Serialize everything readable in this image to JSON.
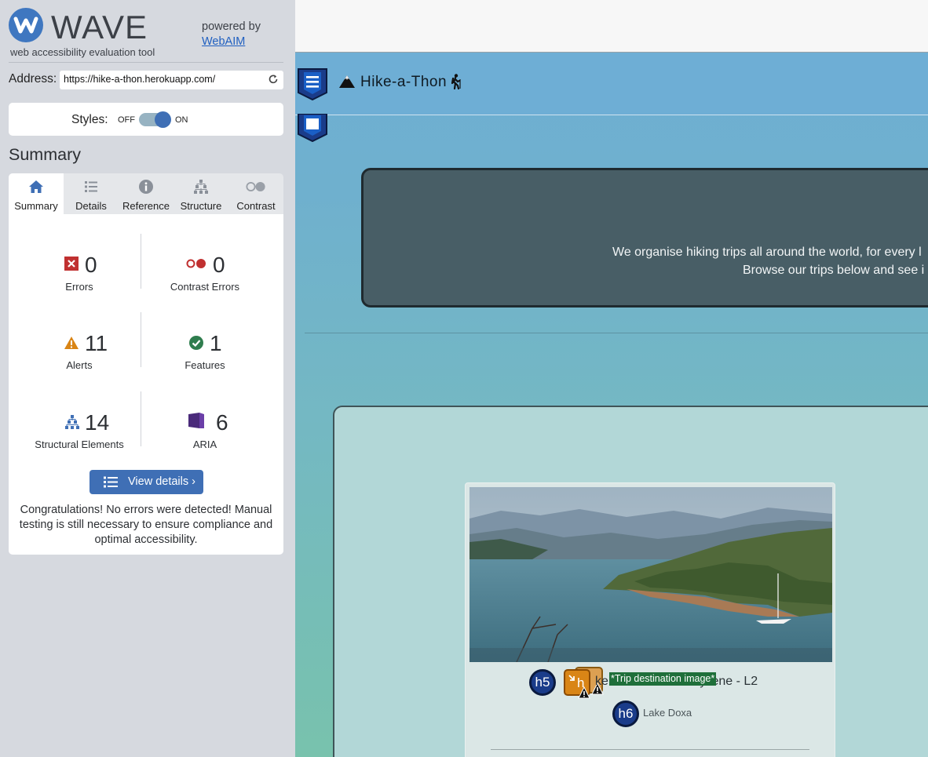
{
  "wave": {
    "logo_text": "WAVE",
    "tagline": "web accessibility evaluation tool",
    "powered_by": "powered by",
    "powered_link": "WebAIM",
    "address_label": "Address:",
    "address_value": "https://hike-a-thon.herokuapp.com/",
    "styles_label": "Styles:",
    "styles_off": "OFF",
    "styles_on": "ON",
    "styles_enabled": true,
    "summary_heading": "Summary",
    "tabs": [
      {
        "label": "Summary",
        "icon": "home-icon",
        "active": true
      },
      {
        "label": "Details",
        "icon": "list-icon",
        "active": false
      },
      {
        "label": "Reference",
        "icon": "info-icon",
        "active": false
      },
      {
        "label": "Structure",
        "icon": "structure-icon",
        "active": false
      },
      {
        "label": "Contrast",
        "icon": "contrast-icon",
        "active": false
      }
    ],
    "stats": {
      "errors": {
        "count": "0",
        "label": "Errors"
      },
      "contrast_errors": {
        "count": "0",
        "label": "Contrast Errors"
      },
      "alerts": {
        "count": "11",
        "label": "Alerts"
      },
      "features": {
        "count": "1",
        "label": "Features"
      },
      "structural": {
        "count": "14",
        "label": "Structural Elements"
      },
      "aria": {
        "count": "6",
        "label": "ARIA"
      }
    },
    "view_details_label": "View details ›",
    "congrats": "Congratulations! No errors were detected! Manual testing is still necessary to ensure compliance and optimal accessibility."
  },
  "site": {
    "brand": "Hike-a-Thon",
    "hero_line1": "We organise hiking trips all around the world, for every l",
    "hero_line2": "Browse our trips below and see i",
    "trip_title": "ke Doxa - Mount Cyllene - L2",
    "trip_subtitle": "Lake Doxa",
    "alt_text_label": "*Trip destination image*",
    "badges": {
      "h5": "h5",
      "h6": "h6",
      "alert_h": "h"
    }
  },
  "colors": {
    "wave_blue": "#3f6fb5",
    "error_red": "#c03030",
    "alert_orange": "#d98516",
    "feature_green": "#2f7d4e",
    "aria_purple": "#4a2a7a",
    "hero_bg": "#485e66"
  }
}
